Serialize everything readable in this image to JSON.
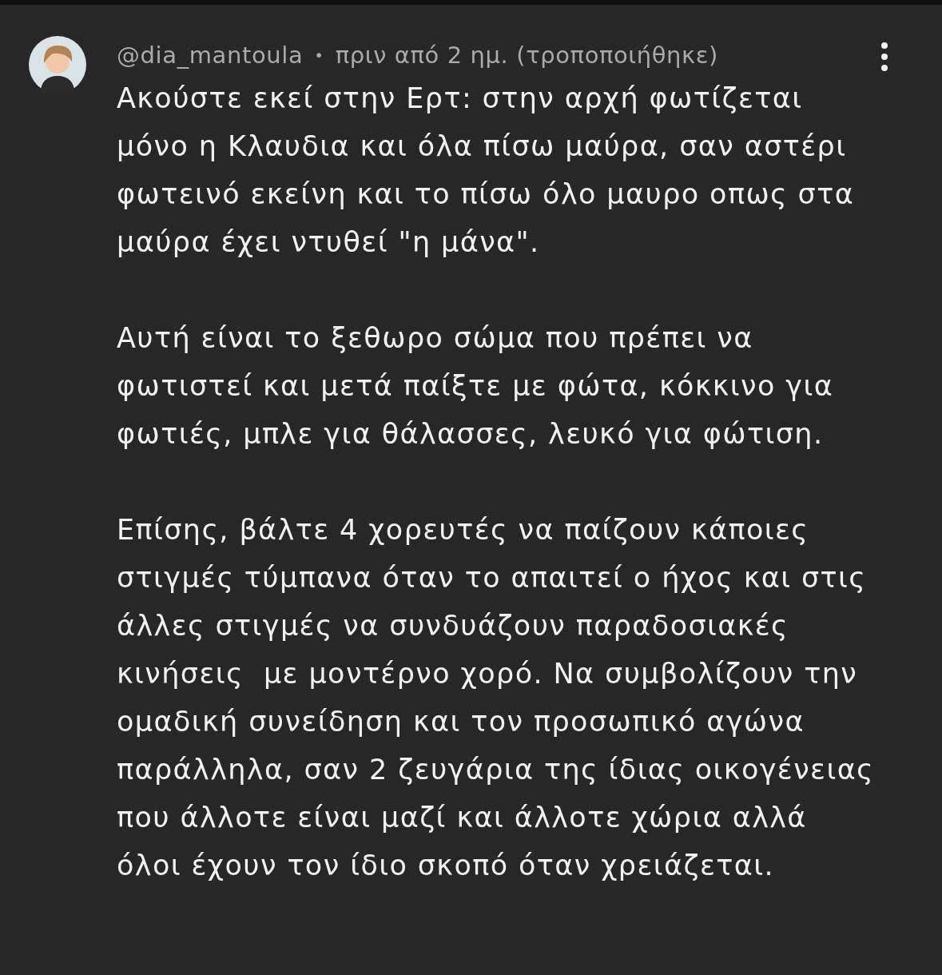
{
  "comment": {
    "author": "@dia_mantoula",
    "separator": "•",
    "time": "πριν από 2 ημ. (τροποποιήθηκε)",
    "paragraphs": [
      "Ακούστε εκεί στην Ερτ: στην αρχή φωτίζεται μόνο η Κλαυδια και όλα πίσω μαύρα, σαν αστέρι φωτεινό εκείνη και το πίσω όλο μαυρο οπως στα μαύρα έχει ντυθεί \"η μάνα\".",
      "Αυτή είναι το ξεθωρο σώμα που πρέπει να φωτιστεί και μετά παίξτε με φώτα, κόκκινο για φωτιές, μπλε για θάλασσες, λευκό για φώτιση.",
      "Επίσης, βάλτε 4 χορευτές να παίζουν κάποιες στιγμές τύμπανα όταν το απαιτεί ο ήχος και στις άλλες στιγμές να συνδυάζουν παραδοσιακές κινήσεις  με μοντέρνο χορό. Να συμβολίζουν την ομαδική συνείδηση και τον προσωπικό αγώνα παράλληλα, σαν 2 ζευγάρια της ίδιας οικογένειας που άλλοτε είναι μαζί και άλλοτε χώρια αλλά όλοι έχουν τον ίδιο σκοπό όταν χρειάζεται."
    ]
  }
}
